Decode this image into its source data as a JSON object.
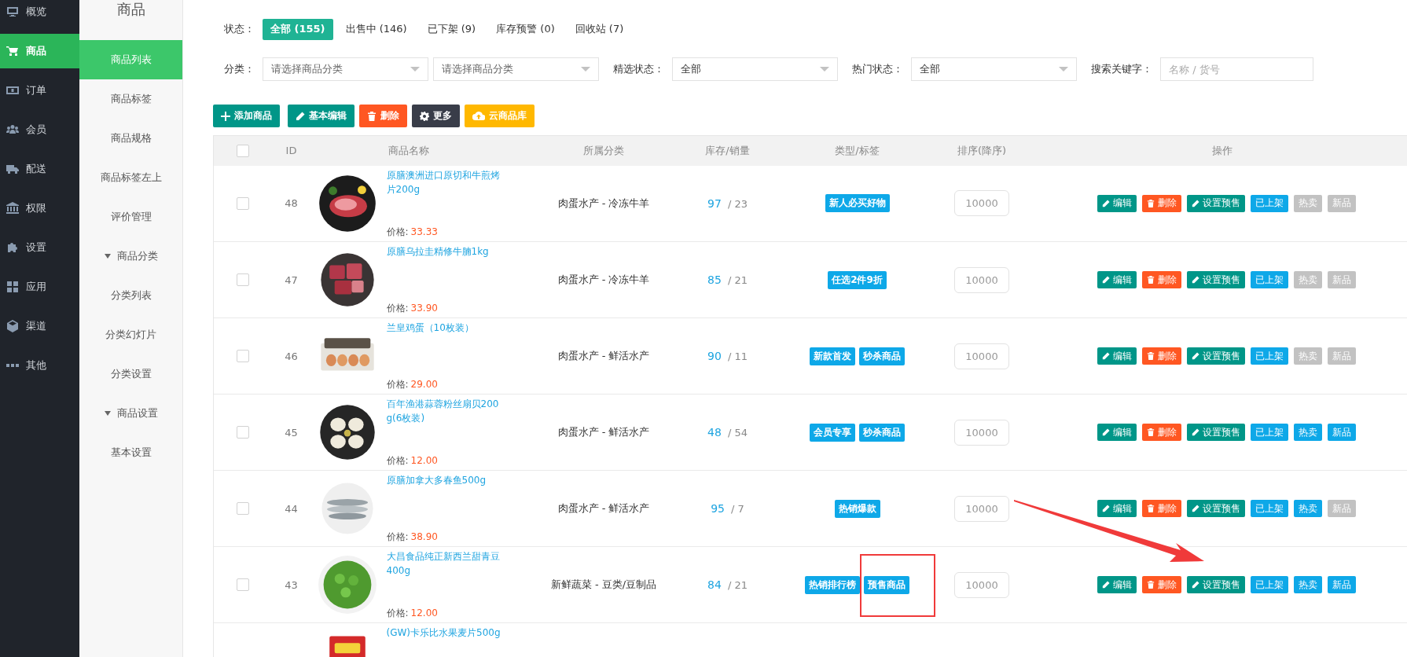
{
  "nav": {
    "items": [
      {
        "label": "概览",
        "selected": false
      },
      {
        "label": "商品",
        "selected": true
      },
      {
        "label": "订单",
        "selected": false
      },
      {
        "label": "会员",
        "selected": false
      },
      {
        "label": "配送",
        "selected": false
      },
      {
        "label": "权限",
        "selected": false
      },
      {
        "label": "设置",
        "selected": false
      },
      {
        "label": "应用",
        "selected": false
      },
      {
        "label": "渠道",
        "selected": false
      },
      {
        "label": "其他",
        "selected": false
      }
    ]
  },
  "subnav": {
    "title": "商品",
    "items": [
      {
        "kind": "link",
        "label": "商品列表",
        "selected": true
      },
      {
        "kind": "link",
        "label": "商品标签",
        "selected": false
      },
      {
        "kind": "link",
        "label": "商品规格",
        "selected": false
      },
      {
        "kind": "link",
        "label": "商品标签左上",
        "selected": false
      },
      {
        "kind": "link",
        "label": "评价管理",
        "selected": false
      },
      {
        "kind": "group",
        "label": "商品分类",
        "expanded": true,
        "children": [
          {
            "label": "分类列表",
            "selected": false
          },
          {
            "label": "分类幻灯片",
            "selected": false
          },
          {
            "label": "分类设置",
            "selected": false
          }
        ]
      },
      {
        "kind": "group",
        "label": "商品设置",
        "expanded": true,
        "children": [
          {
            "label": "基本设置",
            "selected": false
          }
        ]
      }
    ]
  },
  "status_filter": {
    "label": "状态：",
    "options": [
      {
        "label": "全部 (155)",
        "selected": true
      },
      {
        "label": "出售中 (146)",
        "selected": false
      },
      {
        "label": "已下架 (9)",
        "selected": false
      },
      {
        "label": "库存预警 (0)",
        "selected": false
      },
      {
        "label": "回收站 (7)",
        "selected": false
      }
    ]
  },
  "filters": [
    {
      "label": "分类：",
      "selects": [
        {
          "placeholder": "请选择商品分类"
        },
        {
          "placeholder": "请选择商品分类"
        }
      ]
    },
    {
      "label": "精选状态：",
      "selects": [
        {
          "value": "全部"
        }
      ]
    },
    {
      "label": "热门状态：",
      "selects": [
        {
          "value": "全部"
        }
      ]
    }
  ],
  "search": {
    "label": "搜索关键字：",
    "placeholder": "名称 / 货号"
  },
  "toolbar": [
    {
      "kind": "add",
      "label": "添加商品"
    },
    {
      "kind": "edit",
      "label": "基本编辑"
    },
    {
      "kind": "delete",
      "label": "删除"
    },
    {
      "kind": "more",
      "label": "更多"
    },
    {
      "kind": "cloud",
      "label": "云商品库"
    }
  ],
  "table": {
    "checked": false,
    "columns": [
      "ID",
      "商品名称",
      "所属分类",
      "库存/销量",
      "类型/标签",
      "排序(降序)",
      "操作"
    ],
    "rows": [
      {
        "checked": false,
        "id": "48",
        "name": "原膳澳洲进口原切和牛煎烤片200g",
        "price_label": "价格:",
        "price": "33.33",
        "category": "肉蛋水产 - 冷冻牛羊",
        "stock": "97",
        "sales": "/ 23",
        "tags": [
          "新人必买好物"
        ],
        "sort": "10000",
        "actions": [
          {
            "kind": "edit",
            "label": "编辑"
          },
          {
            "kind": "delete",
            "label": "删除"
          },
          {
            "kind": "presale",
            "label": "设置预售"
          },
          {
            "kind": "toggle",
            "label": "已上架",
            "on": true
          },
          {
            "kind": "toggle",
            "label": "热卖",
            "on": false
          },
          {
            "kind": "toggle",
            "label": "新品",
            "on": false
          }
        ]
      },
      {
        "checked": false,
        "id": "47",
        "name": "原膳乌拉圭精修牛腩1kg",
        "price_label": "价格:",
        "price": "33.90",
        "category": "肉蛋水产 - 冷冻牛羊",
        "stock": "85",
        "sales": "/ 21",
        "tags": [
          "任选2件9折"
        ],
        "sort": "10000",
        "actions": [
          {
            "kind": "edit",
            "label": "编辑"
          },
          {
            "kind": "delete",
            "label": "删除"
          },
          {
            "kind": "presale",
            "label": "设置预售"
          },
          {
            "kind": "toggle",
            "label": "已上架",
            "on": true
          },
          {
            "kind": "toggle",
            "label": "热卖",
            "on": false
          },
          {
            "kind": "toggle",
            "label": "新品",
            "on": false
          }
        ]
      },
      {
        "checked": false,
        "id": "46",
        "name": "兰皇鸡蛋（10枚装）",
        "price_label": "价格:",
        "price": "29.00",
        "category": "肉蛋水产 - 鲜活水产",
        "stock": "90",
        "sales": "/ 11",
        "tags": [
          "新款首发",
          "秒杀商品"
        ],
        "sort": "10000",
        "actions": [
          {
            "kind": "edit",
            "label": "编辑"
          },
          {
            "kind": "delete",
            "label": "删除"
          },
          {
            "kind": "presale",
            "label": "设置预售"
          },
          {
            "kind": "toggle",
            "label": "已上架",
            "on": true
          },
          {
            "kind": "toggle",
            "label": "热卖",
            "on": false
          },
          {
            "kind": "toggle",
            "label": "新品",
            "on": false
          }
        ]
      },
      {
        "checked": false,
        "id": "45",
        "name": "百年渔港蒜蓉粉丝扇贝200g(6枚装)",
        "price_label": "价格:",
        "price": "12.00",
        "category": "肉蛋水产 - 鲜活水产",
        "stock": "48",
        "sales": "/ 54",
        "tags": [
          "会员专享",
          "秒杀商品"
        ],
        "sort": "10000",
        "actions": [
          {
            "kind": "edit",
            "label": "编辑"
          },
          {
            "kind": "delete",
            "label": "删除"
          },
          {
            "kind": "presale",
            "label": "设置预售"
          },
          {
            "kind": "toggle",
            "label": "已上架",
            "on": true
          },
          {
            "kind": "toggle",
            "label": "热卖",
            "on": true
          },
          {
            "kind": "toggle",
            "label": "新品",
            "on": true
          }
        ]
      },
      {
        "checked": false,
        "id": "44",
        "name": "原膳加拿大多春鱼500g",
        "price_label": "价格:",
        "price": "38.90",
        "category": "肉蛋水产 - 鲜活水产",
        "stock": "95",
        "sales": "/ 7",
        "tags": [
          "热销爆款"
        ],
        "sort": "10000",
        "actions": [
          {
            "kind": "edit",
            "label": "编辑"
          },
          {
            "kind": "delete",
            "label": "删除"
          },
          {
            "kind": "presale",
            "label": "设置预售"
          },
          {
            "kind": "toggle",
            "label": "已上架",
            "on": true
          },
          {
            "kind": "toggle",
            "label": "热卖",
            "on": true
          },
          {
            "kind": "toggle",
            "label": "新品",
            "on": false
          }
        ]
      },
      {
        "checked": false,
        "id": "43",
        "name": "大昌食品纯正新西兰甜青豆400g",
        "price_label": "价格:",
        "price": "12.00",
        "category": "新鲜蔬菜 - 豆类/豆制品",
        "stock": "84",
        "sales": "/ 21",
        "tags": [
          "热销排行榜",
          "预售商品"
        ],
        "sort": "10000",
        "actions": [
          {
            "kind": "edit",
            "label": "编辑"
          },
          {
            "kind": "delete",
            "label": "删除"
          },
          {
            "kind": "presale",
            "label": "设置预售"
          },
          {
            "kind": "toggle",
            "label": "已上架",
            "on": true
          },
          {
            "kind": "toggle",
            "label": "热卖",
            "on": true
          },
          {
            "kind": "toggle",
            "label": "新品",
            "on": true
          }
        ]
      },
      {
        "name": "(GW)卡乐比水果麦片500g"
      }
    ]
  }
}
